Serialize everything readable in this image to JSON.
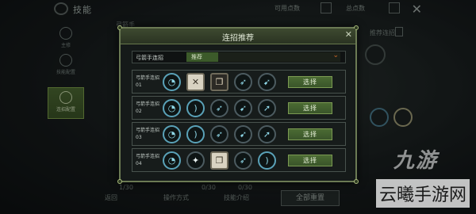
{
  "topbar": {
    "title": "技能",
    "available_points_label": "可用点数",
    "total_points_label": "总点数",
    "close_glyph": "✕"
  },
  "leftnav": {
    "items": [
      {
        "label": "主修"
      },
      {
        "label": "技能配置"
      },
      {
        "label": "连招配置"
      }
    ]
  },
  "background": {
    "class_name": "弓箭手",
    "preset_label": "推荐连招",
    "bottom_labels": [
      "返回",
      "操作方式",
      "技能介绍"
    ],
    "level_labels": [
      "1/30",
      "0/30",
      "0/30"
    ],
    "reset_label": "全部重置"
  },
  "modal": {
    "title": "连招推荐",
    "close_glyph": "✕",
    "select_label": "弓箭手连招",
    "select_value": "推荐",
    "combos": [
      {
        "name": "弓箭手连招01",
        "skills": [
          "blue-swirl",
          "crossed-swords",
          "scroll",
          "arrow",
          "arrow"
        ],
        "button": "选择"
      },
      {
        "name": "弓箭手连招02",
        "skills": [
          "blue-swirl",
          "bow",
          "arrow",
          "arrow",
          "arrow"
        ],
        "button": "选择"
      },
      {
        "name": "弓箭手连招03",
        "skills": [
          "blue-swirl",
          "bow",
          "arrow",
          "arrow",
          "arrow"
        ],
        "button": "选择"
      },
      {
        "name": "弓箭手连招04",
        "skills": [
          "blue-swirl",
          "walking-figure",
          "scroll",
          "arrow",
          "bow"
        ],
        "button": "选择"
      }
    ]
  },
  "watermark": {
    "logo": "九游",
    "text": "云曦手游网"
  },
  "colors": {
    "accent_green": "#4b6b33",
    "select_orange": "#d46b28",
    "skill_blue": "#8fd8e8"
  }
}
